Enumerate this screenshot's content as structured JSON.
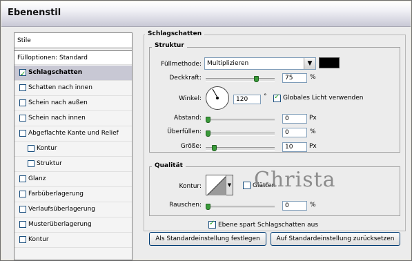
{
  "window": {
    "title": "Ebenenstil"
  },
  "sidebar": {
    "styles_header": "Stile",
    "blend_options": "Fülloptionen: Standard",
    "items": [
      {
        "label": "Schlagschatten",
        "checked": true,
        "selected": true,
        "indent": false
      },
      {
        "label": "Schatten nach innen",
        "checked": false,
        "selected": false,
        "indent": false
      },
      {
        "label": "Schein nach außen",
        "checked": false,
        "selected": false,
        "indent": false
      },
      {
        "label": "Schein nach innen",
        "checked": false,
        "selected": false,
        "indent": false
      },
      {
        "label": "Abgeflachte Kante und Relief",
        "checked": false,
        "selected": false,
        "indent": false
      },
      {
        "label": "Kontur",
        "checked": false,
        "selected": false,
        "indent": true
      },
      {
        "label": "Struktur",
        "checked": false,
        "selected": false,
        "indent": true
      },
      {
        "label": "Glanz",
        "checked": false,
        "selected": false,
        "indent": false
      },
      {
        "label": "Farbüberlagerung",
        "checked": false,
        "selected": false,
        "indent": false
      },
      {
        "label": "Verlaufsüberlagerung",
        "checked": false,
        "selected": false,
        "indent": false
      },
      {
        "label": "Musterüberlagerung",
        "checked": false,
        "selected": false,
        "indent": false
      },
      {
        "label": "Kontur",
        "checked": false,
        "selected": false,
        "indent": false
      }
    ]
  },
  "panel": {
    "title": "Schlagschatten",
    "structure": {
      "title": "Struktur",
      "blend_mode_label": "Füllmethode:",
      "blend_mode_value": "Multiplizieren",
      "shadow_color": "#000000",
      "opacity_label": "Deckkraft:",
      "opacity_value": "75",
      "opacity_unit": "%",
      "opacity_fraction": 0.75,
      "angle_label": "Winkel:",
      "angle_value": "120",
      "angle_unit": "°",
      "global_light_label": "Globales Licht verwenden",
      "global_light_checked": true,
      "distance_label": "Abstand:",
      "distance_value": "0",
      "distance_unit": "Px",
      "spread_label": "Überfüllen:",
      "spread_value": "0",
      "spread_unit": "%",
      "size_label": "Größe:",
      "size_value": "10",
      "size_unit": "Px"
    },
    "quality": {
      "title": "Qualität",
      "contour_label": "Kontur:",
      "antialias_label": "Glätten",
      "antialias_checked": false,
      "noise_label": "Rauschen:",
      "noise_value": "0",
      "noise_unit": "%"
    },
    "knockout_label": "Ebene spart Schlagschatten aus",
    "knockout_checked": true,
    "make_default_button": "Als Standardeinstellung festlegen",
    "reset_default_button": "Auf Standardeinstellung zurücksetzen"
  },
  "watermark": "Christa"
}
